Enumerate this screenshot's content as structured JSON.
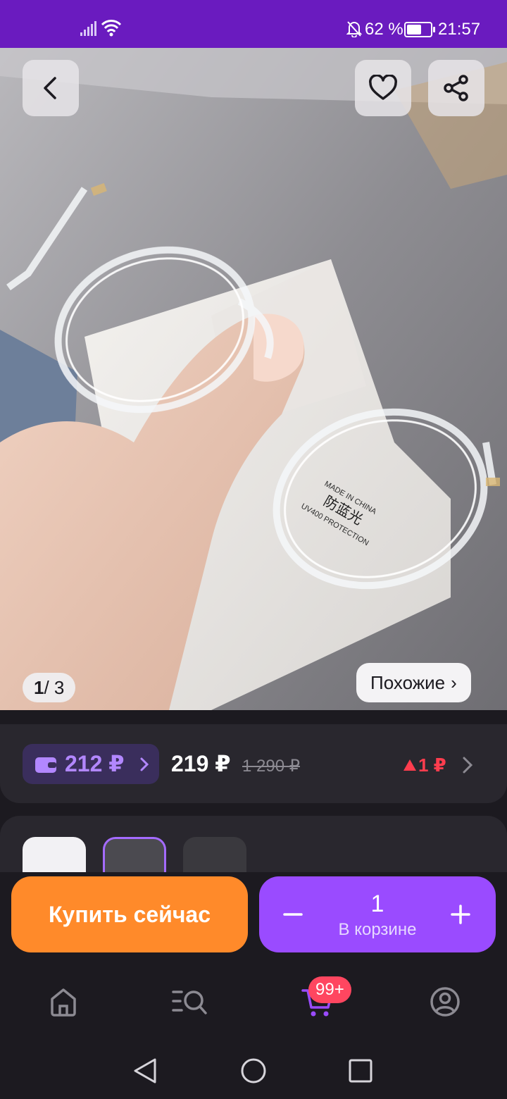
{
  "status_bar": {
    "battery_text": "62 %",
    "battery_level": 0.62,
    "time": "21:57",
    "icons": [
      "signal-icon",
      "wifi-icon",
      "bell-off-icon",
      "battery-icon"
    ]
  },
  "gallery": {
    "counter_current": "1",
    "counter_total": "/ 3",
    "similar_label": "Похожие",
    "similar_chevron": "›",
    "lens_print": [
      "MADE IN CHINA",
      "防蓝光",
      "UV400 PROTECTION"
    ],
    "icons": [
      "back-icon",
      "heart-icon",
      "share-icon"
    ]
  },
  "price": {
    "wallet_price": "212 ₽",
    "current": "219 ₽",
    "old": "1 290 ₽",
    "delta": "1 ₽",
    "colors": {
      "wallet": "#b287ff",
      "delta": "#ff3d4e"
    }
  },
  "actions": {
    "buy_label": "Купить сейчас",
    "quantity": "1",
    "cart_label": "В корзине",
    "colors": {
      "buy": "#ff8a2a",
      "cart": "#9a4bff"
    }
  },
  "bottom_nav": {
    "items": [
      "home-icon",
      "catalog-search-icon",
      "cart-icon",
      "profile-icon"
    ],
    "cart_badge": "99+",
    "accent": "#9a4bff"
  },
  "system_nav": {
    "items": [
      "back-triangle-icon",
      "home-circle-icon",
      "recents-square-icon"
    ]
  }
}
